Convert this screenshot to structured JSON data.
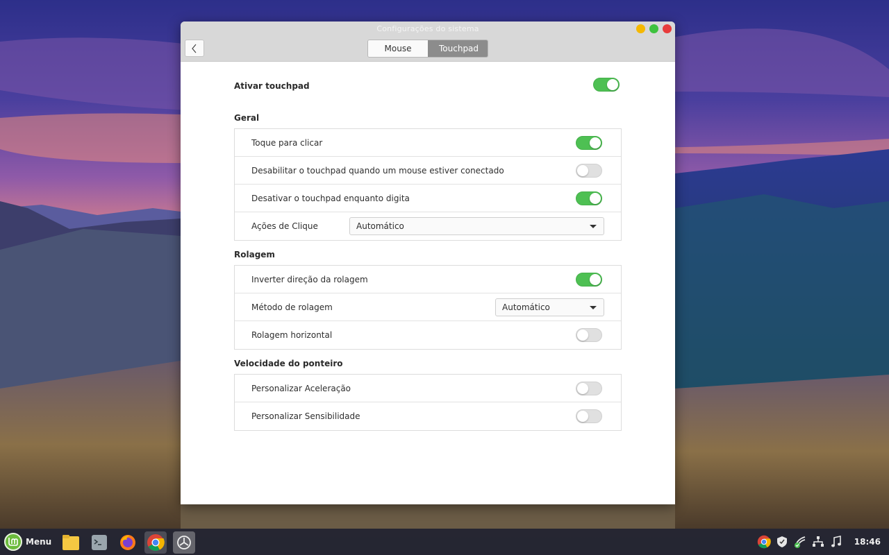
{
  "window": {
    "title": "Configurações do sistema",
    "tabs": [
      {
        "label": "Mouse",
        "active": false
      },
      {
        "label": "Touchpad",
        "active": true
      }
    ]
  },
  "main_toggle": {
    "label": "Ativar touchpad",
    "on": true
  },
  "sections": {
    "geral": {
      "title": "Geral",
      "rows": [
        {
          "label": "Toque para clicar",
          "type": "toggle",
          "on": true
        },
        {
          "label": "Desabilitar o touchpad quando um mouse estiver conectado",
          "type": "toggle",
          "on": false
        },
        {
          "label": "Desativar o touchpad enquanto digita",
          "type": "toggle",
          "on": true
        },
        {
          "label": "Ações de Clique",
          "type": "select",
          "value": "Automático"
        }
      ]
    },
    "rolagem": {
      "title": "Rolagem",
      "rows": [
        {
          "label": "Inverter direção da rolagem",
          "type": "toggle",
          "on": true
        },
        {
          "label": "Método de rolagem",
          "type": "select",
          "value": "Automático"
        },
        {
          "label": "Rolagem horizontal",
          "type": "toggle",
          "on": false
        }
      ]
    },
    "velocidade": {
      "title": "Velocidade do ponteiro",
      "rows": [
        {
          "label": "Personalizar Aceleração",
          "type": "toggle",
          "on": false
        },
        {
          "label": "Personalizar Sensibilidade",
          "type": "toggle",
          "on": false
        }
      ]
    }
  },
  "taskbar": {
    "menu_label": "Menu",
    "launchers": [
      "files-icon",
      "terminal-icon",
      "firefox-icon",
      "chrome-icon",
      "system-settings-icon"
    ],
    "tray": [
      "chrome-icon",
      "shield-icon",
      "update-manager-icon",
      "network-icon",
      "music-icon"
    ],
    "clock": "18:46"
  },
  "colors": {
    "toggle_on": "#4ec053",
    "toggle_off": "#e0e0e0",
    "active_tab": "#8c8c8c",
    "mint_green": "#6cbb3c"
  }
}
